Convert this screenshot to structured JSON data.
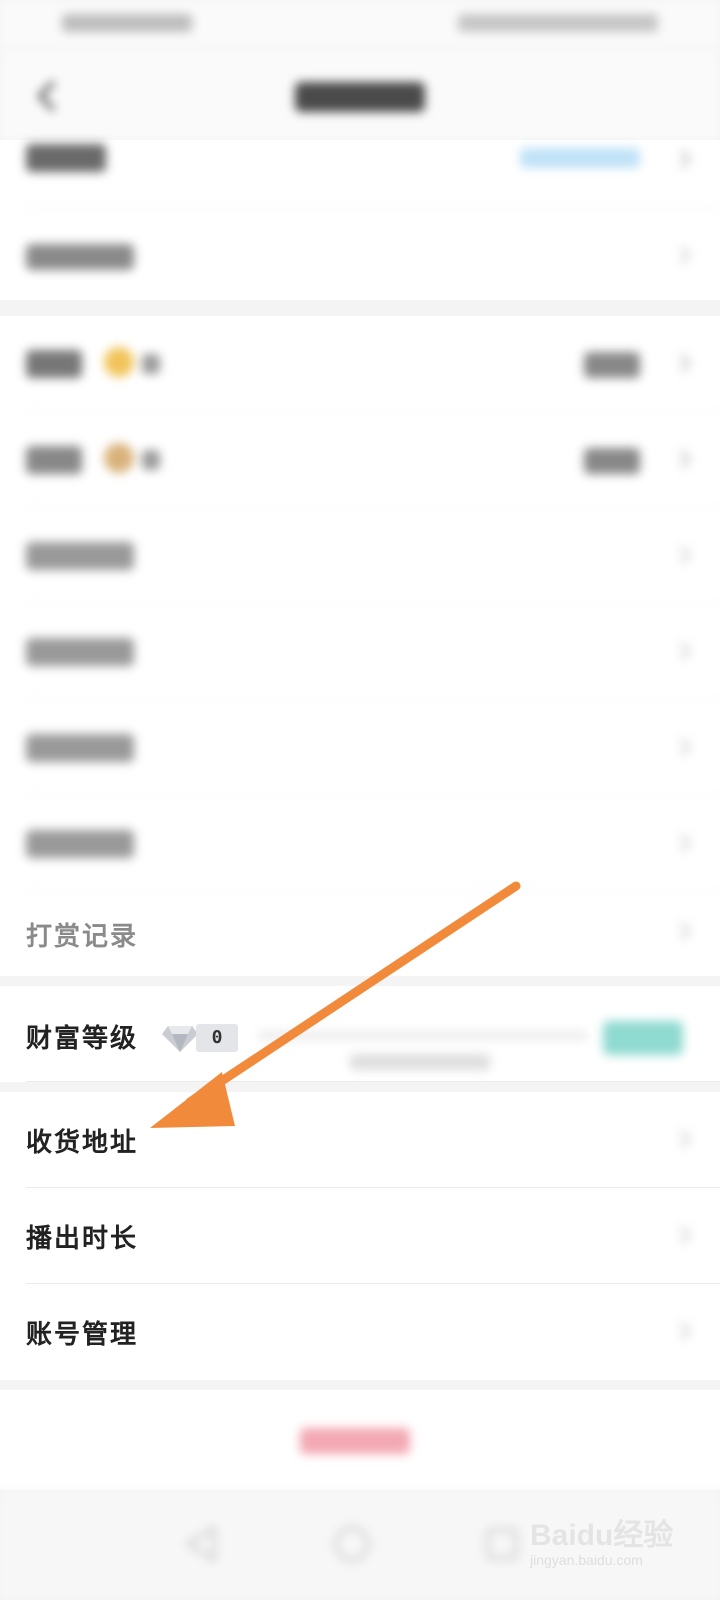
{
  "items": {
    "reward_records": "打赏记录",
    "wealth_level": {
      "label": "财富等级",
      "level": "0",
      "progress": 0
    },
    "shipping_address": "收货地址",
    "broadcast_duration": "播出时长",
    "account_management": "账号管理"
  },
  "icons": {
    "back": "chevron-left-icon",
    "chevron": "chevron-right-icon",
    "gem": "diamond-icon",
    "nav_back": "triangle-back-icon",
    "nav_home": "circle-home-icon",
    "nav_recent": "square-recent-icon"
  },
  "colors": {
    "arrow": "#f28a3c",
    "upgrade_button": "#8fdad1",
    "logout_text": "#f3a8b3",
    "coin": "#f1c45a"
  },
  "watermark": {
    "brand": "Baidu经验",
    "url": "jingyan.baidu.com"
  }
}
